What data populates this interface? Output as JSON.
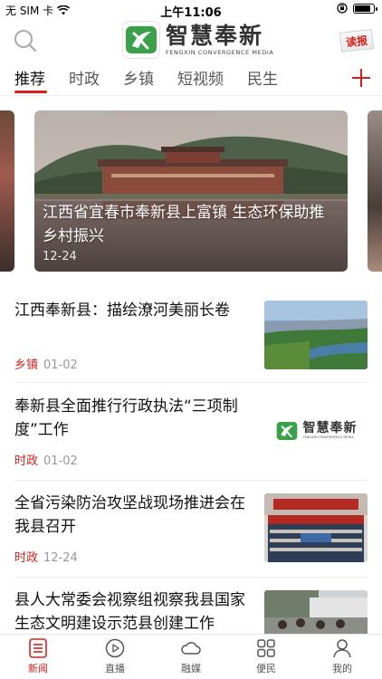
{
  "status_bar": {
    "carrier": "无 SIM 卡",
    "time": "上午11:06",
    "battery_level": 0.9
  },
  "header": {
    "logo_title": "智慧奉新",
    "logo_subtitle": "FENGXIN CONVERGENCE MEDIA",
    "read_paper_label": "读报"
  },
  "tabs": [
    {
      "label": "推荐",
      "active": true
    },
    {
      "label": "时政",
      "active": false
    },
    {
      "label": "乡镇",
      "active": false
    },
    {
      "label": "短视频",
      "active": false
    },
    {
      "label": "民生",
      "active": false
    }
  ],
  "carousel": {
    "title": "江西省宜春市奉新县上富镇 生态环保助推乡村振兴",
    "date": "12-24"
  },
  "news": [
    {
      "title": "江西奉新县：描绘潦河美丽长卷",
      "tag": "乡镇",
      "date": "01-02",
      "thumb": "river-aerial"
    },
    {
      "title": "奉新县全面推行行政执法“三项制度”工作",
      "tag": "时政",
      "date": "01-02",
      "thumb": "logo"
    },
    {
      "title": "全省污染防治攻坚战现场推进会在我县召开",
      "tag": "时政",
      "date": "12-24",
      "thumb": "meeting-hall"
    },
    {
      "title": "县人大常委会视察组视察我县国家生态文明建设示范县创建工作",
      "tag": "",
      "date": "",
      "thumb": "group-visit"
    }
  ],
  "thumb_logo_text": "智慧奉新",
  "thumb_logo_sub": "FENGXIN CONVERGENCE MEDIA",
  "bottom_nav": [
    {
      "label": "新闻",
      "icon": "news-list-icon",
      "active": true
    },
    {
      "label": "直播",
      "icon": "play-circle-icon",
      "active": false
    },
    {
      "label": "融媒",
      "icon": "cloud-icon",
      "active": false
    },
    {
      "label": "便民",
      "icon": "grid-apps-icon",
      "active": false
    },
    {
      "label": "我的",
      "icon": "user-icon",
      "active": false
    }
  ],
  "colors": {
    "accent": "#d7201c",
    "brand_green": "#3aa14a"
  }
}
